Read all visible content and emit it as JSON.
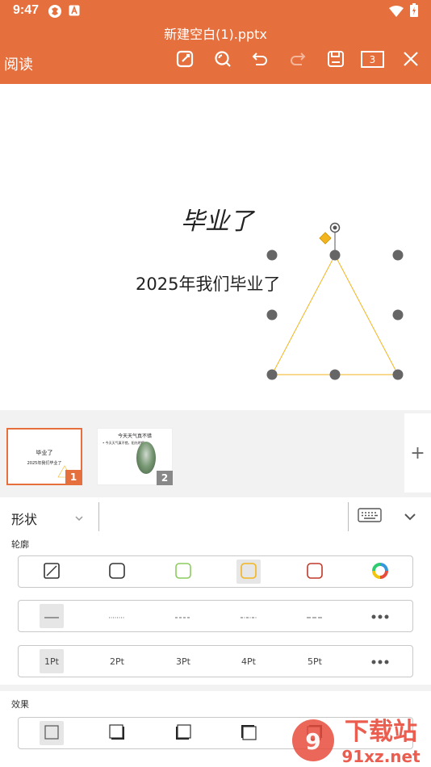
{
  "status_bar": {
    "time": "9:47"
  },
  "toolbar": {
    "doc_title": "新建空白(1).pptx",
    "read_label": "阅读",
    "page_count": "3",
    "icons": [
      "edit-icon",
      "search-icon",
      "undo-icon",
      "redo-icon",
      "save-icon",
      "pages-icon",
      "close-icon"
    ]
  },
  "slide": {
    "title": "毕业了",
    "subtitle": "2025年我们毕业了",
    "selected_shape": "triangle",
    "shape_outline_color": "#F2B51F"
  },
  "thumbnails": [
    {
      "number": "1",
      "title": "毕业了",
      "subtitle": "2025年我们毕业了",
      "selected": true
    },
    {
      "number": "2",
      "title": "今天天气真不错",
      "bullet": "• 今天天气真不错，阳光明媚",
      "selected": false
    }
  ],
  "add_slide_label": "+",
  "panel": {
    "shape_selector": "形状",
    "outline_label": "轮廓",
    "effect_label": "效果",
    "outline_colors": [
      {
        "name": "none",
        "color": "none"
      },
      {
        "name": "black",
        "color": "#333333"
      },
      {
        "name": "green",
        "color": "#8CCB5E"
      },
      {
        "name": "yellow",
        "color": "#F2B51F",
        "selected": true
      },
      {
        "name": "red",
        "color": "#C0392B"
      },
      {
        "name": "more",
        "color": "multi"
      }
    ],
    "line_styles": [
      "solid",
      "dotted",
      "dashed",
      "dash-dot",
      "long-dash",
      "more"
    ],
    "line_widths": [
      "1Pt",
      "2Pt",
      "3Pt",
      "4Pt",
      "5Pt"
    ],
    "selected_width": "1Pt",
    "effects": [
      "none",
      "shadow-bottom-right",
      "shadow-bottom-left",
      "shadow-top-left",
      "shadow-top-right"
    ]
  },
  "colors": {
    "accent": "#E5703D",
    "thumb_badge_gray": "#888888"
  }
}
